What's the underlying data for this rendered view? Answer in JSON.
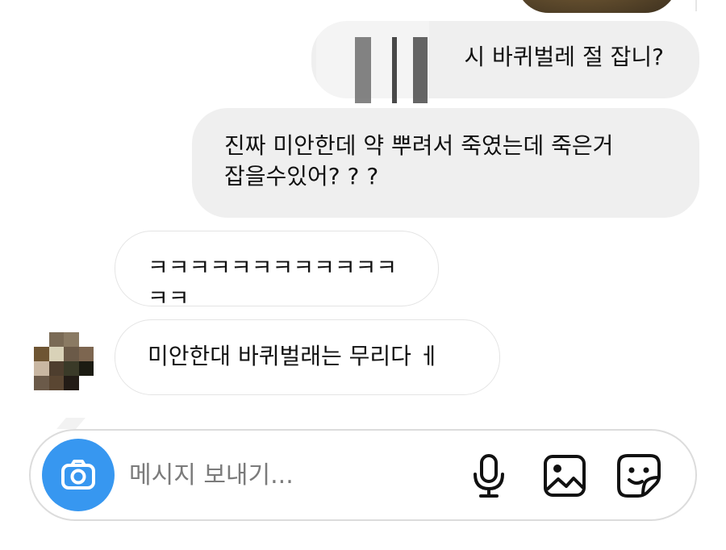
{
  "messages": [
    {
      "direction": "outgoing",
      "text": "시 바퀴벌레 절 잡니?",
      "redacted_prefix": true
    },
    {
      "direction": "outgoing",
      "text": "진짜 미안한데 약 뿌려서 죽였는데 죽은거\n잡을수있어? ? ?"
    },
    {
      "direction": "incoming",
      "text": "ㅋㅋㅋㅋㅋㅋㅋㅋㅋㅋㅋㅋㅋㅋ"
    },
    {
      "direction": "incoming",
      "text": "미안한대 바퀴벌래는 무리다 ㅔ"
    }
  ],
  "composer": {
    "placeholder": "메시지 보내기...",
    "icons": [
      "camera-icon",
      "microphone-icon",
      "gallery-icon",
      "sticker-icon"
    ],
    "accent_color": "#3797f0"
  },
  "colors": {
    "outgoing_bubble": "#efefef",
    "incoming_border": "#e4e4e4"
  }
}
